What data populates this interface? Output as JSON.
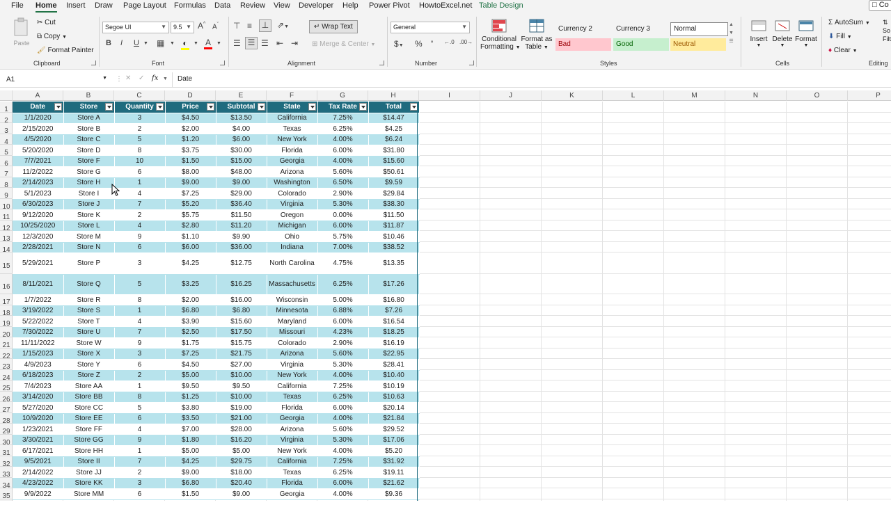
{
  "menu": {
    "tabs": [
      "File",
      "Home",
      "Insert",
      "Draw",
      "Page Layout",
      "Formulas",
      "Data",
      "Review",
      "View",
      "Developer",
      "Help",
      "Power Pivot",
      "HowtoExcel.net",
      "Table Design"
    ],
    "comments_label": "Co"
  },
  "ribbon": {
    "clipboard": {
      "paste": "Paste",
      "cut": "Cut",
      "copy": "Copy",
      "format_painter": "Format Painter",
      "group": "Clipboard"
    },
    "font": {
      "name": "Segoe UI",
      "size": "9.5",
      "grow": "A",
      "shrink": "A",
      "bold": "B",
      "italic": "I",
      "underline": "U",
      "color": "A",
      "group": "Font"
    },
    "alignment": {
      "wrap_text": "Wrap Text",
      "merge_center": "Merge & Center",
      "group": "Alignment"
    },
    "number": {
      "format": "General",
      "group": "Number"
    },
    "styles": {
      "conditional": [
        "Conditional",
        "Formatting"
      ],
      "format_as_table": [
        "Format as",
        "Table"
      ],
      "cells": [
        "Currency 2",
        "Currency 3",
        "Normal",
        "Bad",
        "Good",
        "Neutral"
      ],
      "group": "Styles",
      "colors": {
        "bad_bg": "#ffc7ce",
        "bad_fg": "#9c0006",
        "good_bg": "#c6efce",
        "good_fg": "#006100",
        "neutral_bg": "#ffeb9c",
        "neutral_fg": "#9c5700"
      }
    },
    "cells": {
      "insert": "Insert",
      "delete": "Delete",
      "format": "Format",
      "group": "Cells"
    },
    "editing": {
      "autosum": "AutoSum",
      "fill": "Fill",
      "clear": "Clear",
      "sort": "So",
      "filter": "Filt",
      "group": "Editing"
    }
  },
  "formula_bar": {
    "name_box": "A1",
    "fx": "fx",
    "content": "Date"
  },
  "grid": {
    "columns": [
      "A",
      "B",
      "C",
      "D",
      "E",
      "F",
      "G",
      "H",
      "I",
      "J",
      "K",
      "L",
      "M",
      "N",
      "O",
      "P"
    ],
    "rows": [
      "1",
      "2",
      "3",
      "4",
      "5",
      "6",
      "7",
      "8",
      "9",
      "10",
      "11",
      "12",
      "13",
      "14",
      "15",
      "16",
      "17",
      "18",
      "19",
      "20",
      "21",
      "22",
      "23",
      "24",
      "25",
      "26",
      "27",
      "28",
      "29",
      "30",
      "31",
      "32",
      "33",
      "34",
      "35"
    ]
  },
  "table": {
    "headers": [
      "Date",
      "Store",
      "Quantity",
      "Price",
      "Subtotal",
      "State",
      "Tax Rate",
      "Total"
    ],
    "rows": [
      [
        "1/1/2020",
        "Store A",
        "3",
        "$4.50",
        "$13.50",
        "California",
        "7.25%",
        "$14.47"
      ],
      [
        "2/15/2020",
        "Store B",
        "2",
        "$2.00",
        "$4.00",
        "Texas",
        "6.25%",
        "$4.25"
      ],
      [
        "4/5/2020",
        "Store C",
        "5",
        "$1.20",
        "$6.00",
        "New York",
        "4.00%",
        "$6.24"
      ],
      [
        "5/20/2020",
        "Store D",
        "8",
        "$3.75",
        "$30.00",
        "Florida",
        "6.00%",
        "$31.80"
      ],
      [
        "7/7/2021",
        "Store F",
        "10",
        "$1.50",
        "$15.00",
        "Georgia",
        "4.00%",
        "$15.60"
      ],
      [
        "11/2/2022",
        "Store G",
        "6",
        "$8.00",
        "$48.00",
        "Arizona",
        "5.60%",
        "$50.61"
      ],
      [
        "2/14/2023",
        "Store H",
        "1",
        "$9.00",
        "$9.00",
        "Washington",
        "6.50%",
        "$9.59"
      ],
      [
        "5/1/2023",
        "Store I",
        "4",
        "$7.25",
        "$29.00",
        "Colorado",
        "2.90%",
        "$29.84"
      ],
      [
        "6/30/2023",
        "Store J",
        "7",
        "$5.20",
        "$36.40",
        "Virginia",
        "5.30%",
        "$38.30"
      ],
      [
        "9/12/2020",
        "Store K",
        "2",
        "$5.75",
        "$11.50",
        "Oregon",
        "0.00%",
        "$11.50"
      ],
      [
        "10/25/2020",
        "Store L",
        "4",
        "$2.80",
        "$11.20",
        "Michigan",
        "6.00%",
        "$11.87"
      ],
      [
        "12/3/2020",
        "Store M",
        "9",
        "$1.10",
        "$9.90",
        "Ohio",
        "5.75%",
        "$10.46"
      ],
      [
        "2/28/2021",
        "Store N",
        "6",
        "$6.00",
        "$36.00",
        "Indiana",
        "7.00%",
        "$38.52"
      ],
      [
        "5/29/2021",
        "Store P",
        "3",
        "$4.25",
        "$12.75",
        "North Carolina",
        "4.75%",
        "$13.35"
      ],
      [
        "8/11/2021",
        "Store Q",
        "5",
        "$3.25",
        "$16.25",
        "Massachusetts",
        "6.25%",
        "$17.26"
      ],
      [
        "1/7/2022",
        "Store R",
        "8",
        "$2.00",
        "$16.00",
        "Wisconsin",
        "5.00%",
        "$16.80"
      ],
      [
        "3/19/2022",
        "Store S",
        "1",
        "$6.80",
        "$6.80",
        "Minnesota",
        "6.88%",
        "$7.26"
      ],
      [
        "5/22/2022",
        "Store T",
        "4",
        "$3.90",
        "$15.60",
        "Maryland",
        "6.00%",
        "$16.54"
      ],
      [
        "7/30/2022",
        "Store U",
        "7",
        "$2.50",
        "$17.50",
        "Missouri",
        "4.23%",
        "$18.25"
      ],
      [
        "11/11/2022",
        "Store W",
        "9",
        "$1.75",
        "$15.75",
        "Colorado",
        "2.90%",
        "$16.19"
      ],
      [
        "1/15/2023",
        "Store X",
        "3",
        "$7.25",
        "$21.75",
        "Arizona",
        "5.60%",
        "$22.95"
      ],
      [
        "4/9/2023",
        "Store Y",
        "6",
        "$4.50",
        "$27.00",
        "Virginia",
        "5.30%",
        "$28.41"
      ],
      [
        "6/18/2023",
        "Store Z",
        "2",
        "$5.00",
        "$10.00",
        "New York",
        "4.00%",
        "$10.40"
      ],
      [
        "7/4/2023",
        "Store AA",
        "1",
        "$9.50",
        "$9.50",
        "California",
        "7.25%",
        "$10.19"
      ],
      [
        "3/14/2020",
        "Store BB",
        "8",
        "$1.25",
        "$10.00",
        "Texas",
        "6.25%",
        "$10.63"
      ],
      [
        "5/27/2020",
        "Store CC",
        "5",
        "$3.80",
        "$19.00",
        "Florida",
        "6.00%",
        "$20.14"
      ],
      [
        "10/9/2020",
        "Store EE",
        "6",
        "$3.50",
        "$21.00",
        "Georgia",
        "4.00%",
        "$21.84"
      ],
      [
        "1/23/2021",
        "Store FF",
        "4",
        "$7.00",
        "$28.00",
        "Arizona",
        "5.60%",
        "$29.52"
      ],
      [
        "3/30/2021",
        "Store GG",
        "9",
        "$1.80",
        "$16.20",
        "Virginia",
        "5.30%",
        "$17.06"
      ],
      [
        "6/17/2021",
        "Store HH",
        "1",
        "$5.00",
        "$5.00",
        "New York",
        "4.00%",
        "$5.20"
      ],
      [
        "9/5/2021",
        "Store II",
        "7",
        "$4.25",
        "$29.75",
        "California",
        "7.25%",
        "$31.92"
      ],
      [
        "2/14/2022",
        "Store JJ",
        "2",
        "$9.00",
        "$18.00",
        "Texas",
        "6.25%",
        "$19.11"
      ],
      [
        "4/23/2022",
        "Store KK",
        "3",
        "$6.80",
        "$20.40",
        "Florida",
        "6.00%",
        "$21.62"
      ],
      [
        "9/9/2022",
        "Store MM",
        "6",
        "$1.50",
        "$9.00",
        "Georgia",
        "4.00%",
        "$9.36"
      ]
    ]
  }
}
